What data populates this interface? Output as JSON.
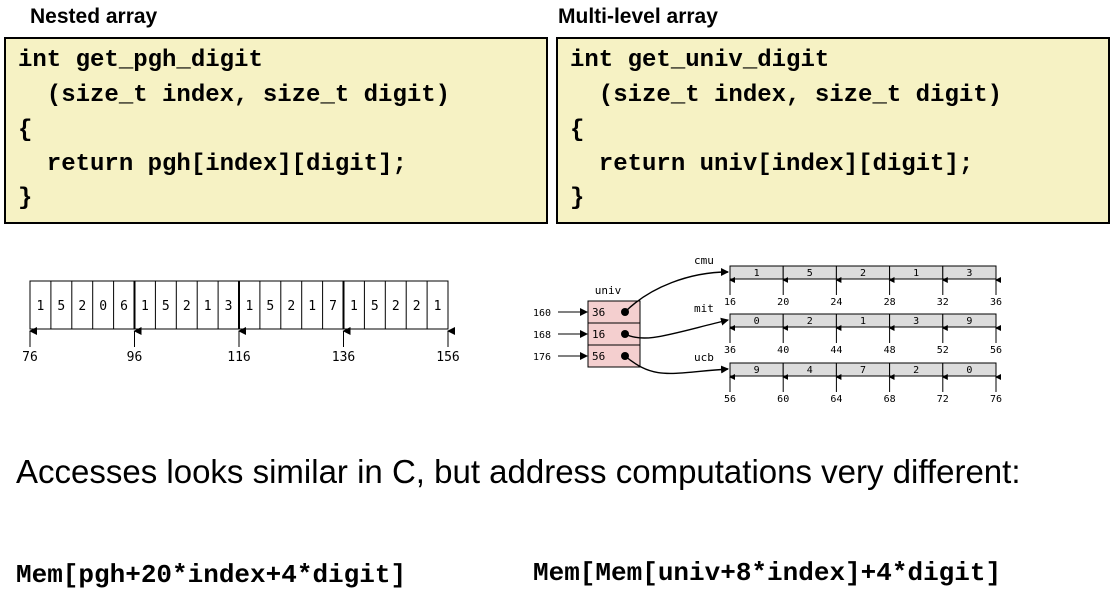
{
  "headings": {
    "nested": "Nested array",
    "multilevel": "Multi-level array"
  },
  "code_nested": [
    "int get_pgh_digit",
    "  (size_t index, size_t digit)",
    "{",
    "  return pgh[index][digit];",
    "}"
  ],
  "code_multi": [
    "int get_univ_digit",
    "  (size_t index, size_t digit)",
    "{",
    "  return univ[index][digit];",
    "}"
  ],
  "nested_array": {
    "cells": [
      "1",
      "5",
      "2",
      "0",
      "6",
      "1",
      "5",
      "2",
      "1",
      "3",
      "1",
      "5",
      "2",
      "1",
      "7",
      "1",
      "5",
      "2",
      "2",
      "1"
    ],
    "addresses": [
      "76",
      "96",
      "116",
      "136",
      "156"
    ]
  },
  "univ": {
    "label": "univ",
    "addresses": [
      "160",
      "168",
      "176"
    ],
    "pointers": [
      "36",
      "16",
      "56"
    ],
    "arrays": [
      {
        "name": "cmu",
        "digits": [
          "1",
          "5",
          "2",
          "1",
          "3"
        ],
        "addresses": [
          "16",
          "20",
          "24",
          "28",
          "32",
          "36"
        ]
      },
      {
        "name": "mit",
        "digits": [
          "0",
          "2",
          "1",
          "3",
          "9"
        ],
        "addresses": [
          "36",
          "40",
          "44",
          "48",
          "52",
          "56"
        ]
      },
      {
        "name": "ucb",
        "digits": [
          "9",
          "4",
          "7",
          "2",
          "0"
        ],
        "addresses": [
          "56",
          "60",
          "64",
          "68",
          "72",
          "76"
        ]
      }
    ]
  },
  "subtitle": "Accesses looks similar in C, but address computations very different:",
  "formulas": {
    "nested": "Mem[pgh+20*index+4*digit]",
    "multi": "Mem[Mem[univ+8*index]+4*digit]"
  }
}
